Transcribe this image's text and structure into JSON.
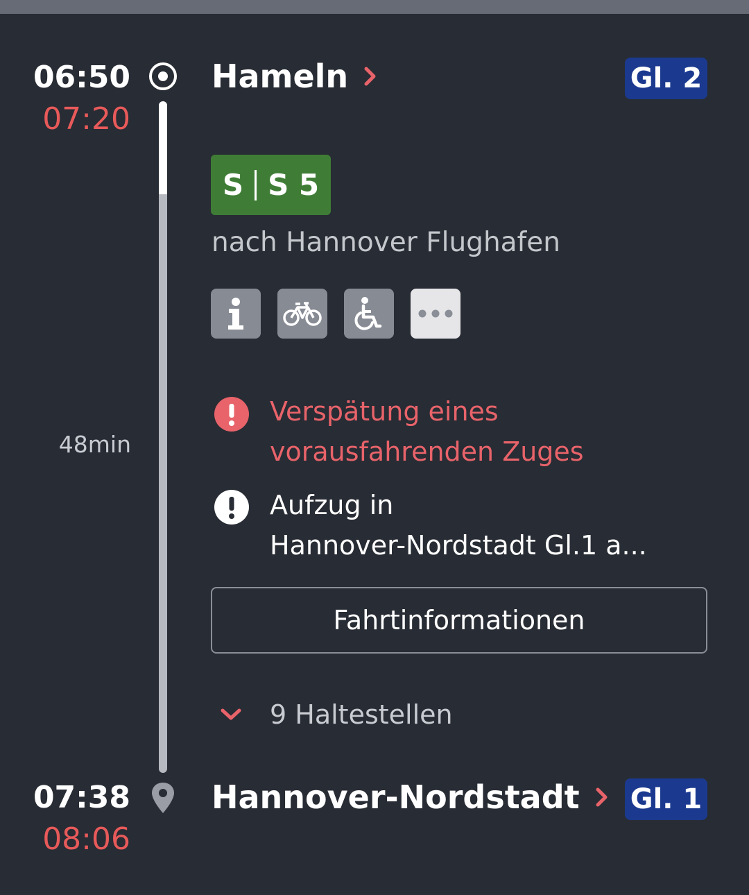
{
  "departure": {
    "scheduled_time": "06:50",
    "actual_time": "07:20",
    "station": "Hameln",
    "platform": "Gl. 2"
  },
  "train": {
    "product": "S",
    "line": "S 5",
    "direction": "nach Hannover Flughafen",
    "line_color": "#3f7d36",
    "attributes": [
      "info-icon",
      "bicycle-icon",
      "wheelchair-icon",
      "more-icon"
    ]
  },
  "duration": "48min",
  "messages": {
    "delay": "Verspätung eines\nvorausfahrenden Zuges",
    "delay_line1": "Verspätung eines",
    "delay_line2": "vorausfahrenden Zuges",
    "elevator_line1": "Aufzug in",
    "elevator_line2": "Hannover-Nordstadt Gl.1 a..."
  },
  "details_button": "Fahrtinformationen",
  "stops": {
    "label": "9 Haltestellen",
    "count": 9
  },
  "arrival": {
    "scheduled_time": "07:38",
    "actual_time": "08:06",
    "station": "Hannover-Nordstadt",
    "platform": "Gl. 1"
  },
  "colors": {
    "background": "#282c34",
    "delay_red": "#e85a5a",
    "platform_blue": "#1b3a8f"
  }
}
